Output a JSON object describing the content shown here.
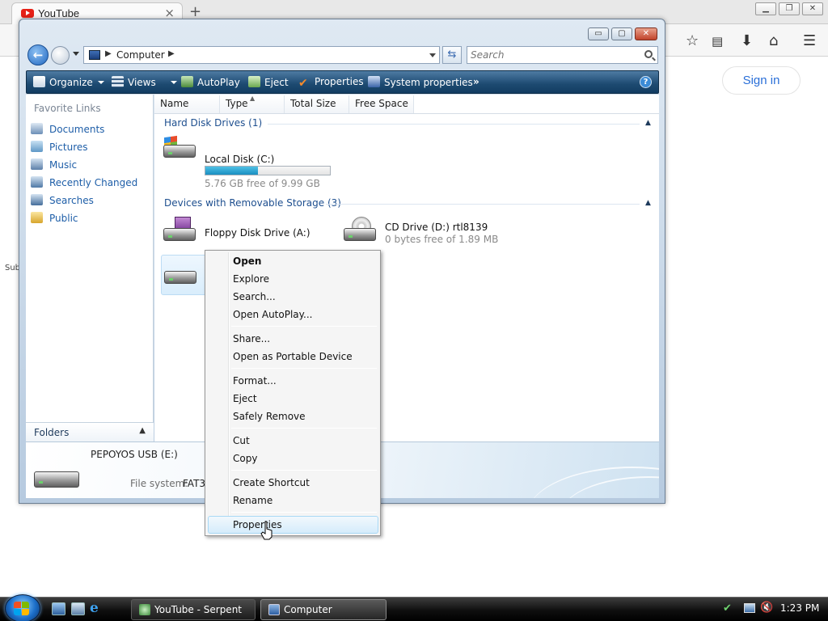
{
  "browser": {
    "tab_title": "YouTube",
    "tab_close": "×",
    "new_tab": "+",
    "window_controls": [
      "▁",
      "❐",
      "✕"
    ],
    "signin_label": "Sign in",
    "clipped_text": "Sub",
    "toolbar_icons": [
      "star-icon",
      "reading-list-icon",
      "download-icon",
      "home-icon",
      "menu-icon"
    ]
  },
  "explorer": {
    "window_controls": [
      "▭",
      "▢",
      "✕"
    ],
    "address": {
      "location": "Computer"
    },
    "search": {
      "placeholder": "Search"
    },
    "commands": [
      {
        "label": "Organize",
        "icon": "organize-icon",
        "dropdown": true
      },
      {
        "label": "Views",
        "icon": "views-icon",
        "dropdown": true
      },
      {
        "label": "AutoPlay",
        "icon": "autoplay-icon",
        "dropdown": false
      },
      {
        "label": "Eject",
        "icon": "eject-icon",
        "dropdown": false
      },
      {
        "label": "Properties",
        "icon": "properties-check-icon",
        "dropdown": false
      },
      {
        "label": "System properties",
        "icon": "system-properties-icon",
        "dropdown": false
      }
    ],
    "more_chevron": "»",
    "help": "?",
    "favorite_links": {
      "title": "Favorite Links",
      "items": [
        "Documents",
        "Pictures",
        "Music",
        "Recently Changed",
        "Searches",
        "Public"
      ]
    },
    "folders_label": "Folders",
    "folders_chevron": "▲",
    "columns": [
      "Name",
      "Type",
      "Total Size",
      "Free Space"
    ],
    "groups": {
      "hard_disks": {
        "title": "Hard Disk Drives (1)",
        "items": [
          {
            "name": "Local Disk (C:)",
            "free": "5.76 GB free of 9.99 GB",
            "used_fraction": 0.42
          }
        ]
      },
      "removable": {
        "title": "Devices with Removable Storage (3)",
        "items": [
          {
            "name": "Floppy Disk Drive (A:)"
          },
          {
            "name": "CD Drive (D:) rtl8139",
            "free": "0 bytes free of 1.89 MB"
          }
        ]
      }
    },
    "group_chevron": "▲",
    "details": {
      "name": "PEPOYOS USB (E:)",
      "fs_label": "File system:",
      "fs_value": "FAT3"
    }
  },
  "context_menu": {
    "items": [
      {
        "label": "Open",
        "bold": true
      },
      {
        "label": "Explore"
      },
      {
        "label": "Search..."
      },
      {
        "label": "Open AutoPlay..."
      },
      {
        "label": "Share..."
      },
      {
        "label": "Open as Portable Device"
      },
      {
        "label": "Format..."
      },
      {
        "label": "Eject"
      },
      {
        "label": "Safely Remove"
      },
      {
        "label": "Cut"
      },
      {
        "label": "Copy"
      },
      {
        "label": "Create Shortcut"
      },
      {
        "label": "Rename"
      },
      {
        "label": "Properties",
        "highlighted": true
      }
    ]
  },
  "taskbar": {
    "tasks": [
      {
        "label": "YouTube - Serpent",
        "icon": "browser-icon",
        "active": false
      },
      {
        "label": "Computer",
        "icon": "computer-icon",
        "active": true
      }
    ],
    "clock": "1:23 PM",
    "tray_icons": [
      "network-icon",
      "display-icon",
      "volume-muted-icon"
    ]
  }
}
